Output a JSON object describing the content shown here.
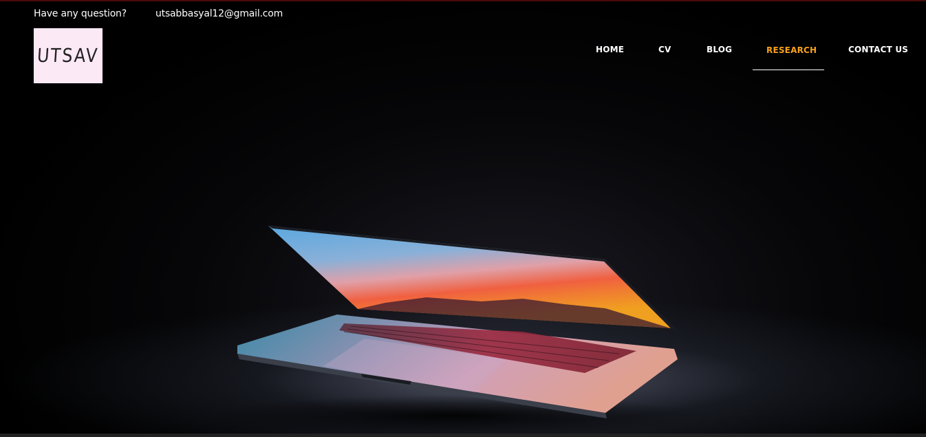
{
  "topbar": {
    "question_label": "Have any question?",
    "email": "utsabbasyal12@gmail.com"
  },
  "logo": {
    "text": "UTSAV"
  },
  "nav": {
    "items": [
      {
        "label": "HOME",
        "active": false
      },
      {
        "label": "CV",
        "active": false
      },
      {
        "label": "BLOG",
        "active": false
      },
      {
        "label": "RESEARCH",
        "active": true
      },
      {
        "label": "CONTACT US",
        "active": false
      }
    ]
  },
  "hero": {
    "image": "laptop-icon"
  },
  "colors": {
    "active_nav": "#f7a21b",
    "logo_bg": "#fce9f6",
    "background": "#000000"
  }
}
